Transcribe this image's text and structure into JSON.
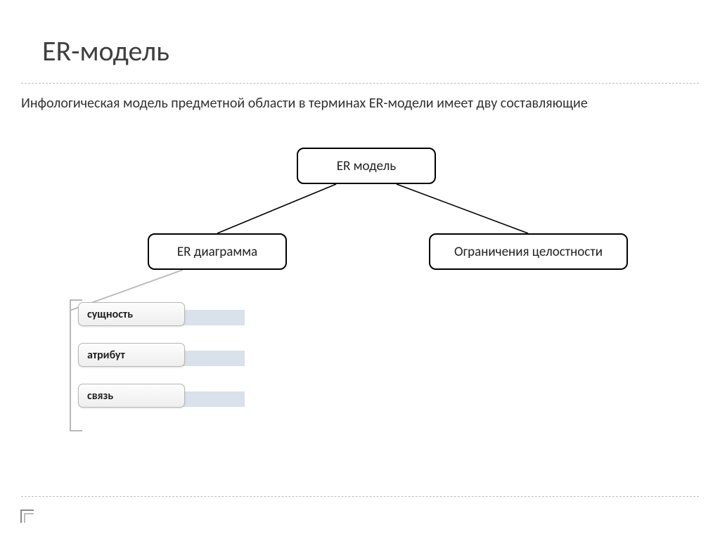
{
  "title": "ER-модель",
  "subtitle": "Инфологическая модель предметной области в терминах ER-модели имеет дву составляющие",
  "diagram": {
    "root": "ER модель",
    "left": "ER диаграмма",
    "right": "Ограничения целостности",
    "list": [
      "сущность",
      "атрибут",
      "связь"
    ]
  }
}
